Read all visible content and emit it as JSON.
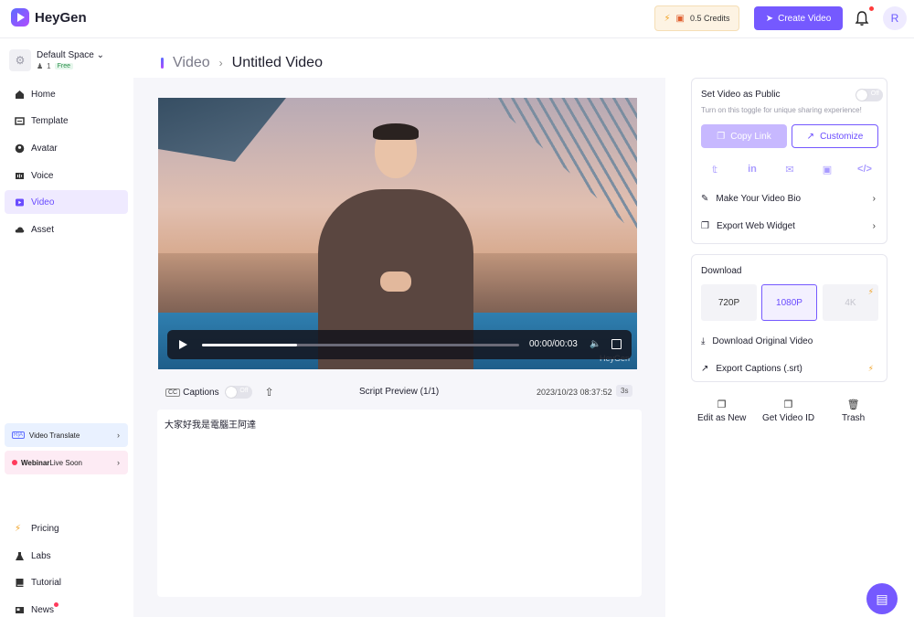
{
  "app": {
    "name": "HeyGen"
  },
  "header": {
    "credits": "0.5 Credits",
    "create_video": "Create Video",
    "avatar_initial": "R"
  },
  "space": {
    "name": "Default Space",
    "members": "1",
    "plan": "Free"
  },
  "sidebar": {
    "items": [
      {
        "label": "Home",
        "icon": "home-icon"
      },
      {
        "label": "Template",
        "icon": "template-icon"
      },
      {
        "label": "Avatar",
        "icon": "avatar-icon"
      },
      {
        "label": "Voice",
        "icon": "voice-icon"
      },
      {
        "label": "Video",
        "icon": "video-icon",
        "active": true
      },
      {
        "label": "Asset",
        "icon": "cloud-icon"
      }
    ],
    "promo_translate": "Video Translate",
    "promo_webinar_bold": "Webinar",
    "promo_webinar_rest": " Live Soon",
    "bottom_items": [
      {
        "label": "Pricing",
        "icon": "bolt-icon"
      },
      {
        "label": "Labs",
        "icon": "flask-icon"
      },
      {
        "label": "Tutorial",
        "icon": "book-icon"
      },
      {
        "label": "News",
        "icon": "news-icon"
      }
    ]
  },
  "breadcrumb": {
    "section": "Video",
    "title": "Untitled Video"
  },
  "player": {
    "time": "00:00/00:03",
    "progress": 0.3,
    "watermark": "HeyGen"
  },
  "captions": {
    "label": "Captions",
    "toggle": "Off",
    "cc": "CC"
  },
  "script": {
    "title": "Script Preview (1/1)",
    "timestamp": "2023/10/23 08:37:52",
    "duration": "3s",
    "text": "大家好我是電腦王阿達"
  },
  "share": {
    "public_title": "Set Video as Public",
    "toggle": "Off",
    "hint": "Turn on this toggle for unique sharing experience!",
    "copy_link": "Copy Link",
    "customize": "Customize",
    "bio": "Make Your Video Bio",
    "widget": "Export Web Widget"
  },
  "download": {
    "title": "Download",
    "res": [
      "720P",
      "1080P",
      "4K"
    ],
    "original": "Download Original Video",
    "captions": "Export Captions (.srt)"
  },
  "actions": {
    "edit": "Edit as New",
    "get_id": "Get Video ID",
    "trash": "Trash"
  },
  "colors": {
    "accent": "#7559ff",
    "accent_light": "#efeaff"
  }
}
